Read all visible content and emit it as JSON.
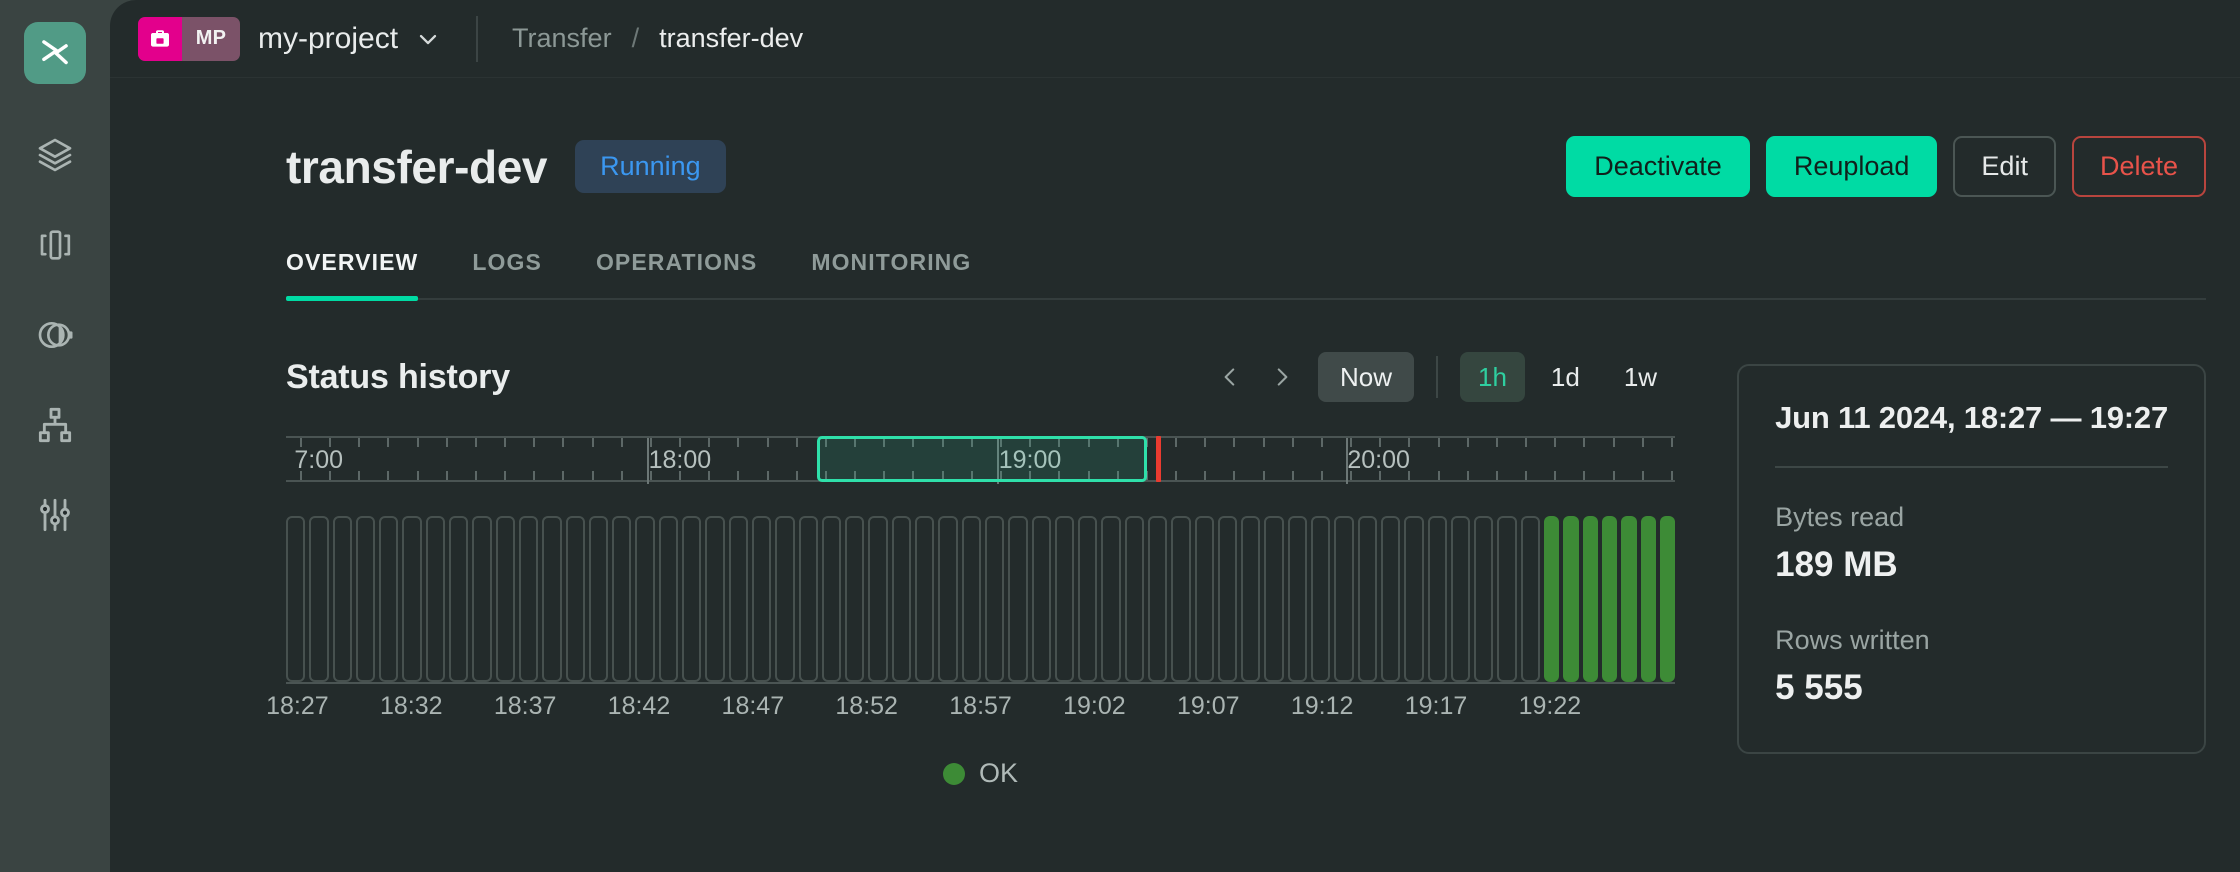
{
  "rail": {
    "logo_icon": "zilliz-logo-icon",
    "items": [
      {
        "icon": "layers-icon",
        "name": "clusters"
      },
      {
        "icon": "brackets-node-icon",
        "name": "pipelines"
      },
      {
        "icon": "contrast-circle-icon",
        "name": "analytics"
      },
      {
        "icon": "hierarchy-icon",
        "name": "topology"
      },
      {
        "icon": "sliders-icon",
        "name": "settings"
      }
    ]
  },
  "topbar": {
    "project_badge": "MP",
    "project_name": "my-project",
    "project_icon": "briefcase-icon",
    "chevron_icon": "chevron-down-icon",
    "breadcrumb": {
      "parent": "Transfer",
      "separator": "/",
      "current": "transfer-dev"
    }
  },
  "header": {
    "title": "transfer-dev",
    "status": "Running",
    "buttons": [
      {
        "label": "Deactivate",
        "style": "primary",
        "name": "deactivate-button"
      },
      {
        "label": "Reupload",
        "style": "primary",
        "name": "reupload-button"
      },
      {
        "label": "Edit",
        "style": "ghost",
        "name": "edit-button"
      },
      {
        "label": "Delete",
        "style": "danger",
        "name": "delete-button"
      }
    ]
  },
  "tabs": [
    {
      "label": "OVERVIEW",
      "active": true
    },
    {
      "label": "LOGS",
      "active": false
    },
    {
      "label": "OPERATIONS",
      "active": false
    },
    {
      "label": "MONITORING",
      "active": false
    }
  ],
  "status_history": {
    "title": "Status history",
    "prev_icon": "chevron-left-icon",
    "next_icon": "chevron-right-icon",
    "now_label": "Now",
    "ranges": [
      {
        "label": "1h",
        "active": true
      },
      {
        "label": "1d",
        "active": false
      },
      {
        "label": "1w",
        "active": false
      }
    ]
  },
  "stats": {
    "date_range": "Jun 11 2024, 18:27 — 19:27",
    "entries": [
      {
        "label": "Bytes read",
        "value": "189 MB"
      },
      {
        "label": "Rows written",
        "value": "5 555"
      }
    ]
  },
  "legend": [
    {
      "label": "OK",
      "color": "#3d8b36"
    }
  ],
  "colors": {
    "accent": "#00dba4",
    "ok": "#3d8b36",
    "danger": "#e8534a",
    "status_text": "#3b97f0",
    "now_marker": "#ea3b30",
    "selection": "#2fe0aa"
  },
  "chart_data": {
    "type": "bar",
    "title": "Status history",
    "xlabel": "",
    "ylabel": "",
    "grid": false,
    "legend_position": "bottom-center",
    "tick_labels": [
      "18:27",
      "18:32",
      "18:37",
      "18:42",
      "18:47",
      "18:52",
      "18:57",
      "19:02",
      "19:07",
      "19:12",
      "19:17",
      "19:22"
    ],
    "tick_indices": [
      0,
      5,
      10,
      15,
      20,
      25,
      30,
      35,
      40,
      45,
      50,
      55
    ],
    "categories": [
      "18:27",
      "18:28",
      "18:29",
      "18:30",
      "18:31",
      "18:32",
      "18:33",
      "18:34",
      "18:35",
      "18:36",
      "18:37",
      "18:38",
      "18:39",
      "18:40",
      "18:41",
      "18:42",
      "18:43",
      "18:44",
      "18:45",
      "18:46",
      "18:47",
      "18:48",
      "18:49",
      "18:50",
      "18:51",
      "18:52",
      "18:53",
      "18:54",
      "18:55",
      "18:56",
      "18:57",
      "18:58",
      "18:59",
      "19:00",
      "19:01",
      "19:02",
      "19:03",
      "19:04",
      "19:05",
      "19:06",
      "19:07",
      "19:08",
      "19:09",
      "19:10",
      "19:11",
      "19:12",
      "19:13",
      "19:14",
      "19:15",
      "19:16",
      "19:17",
      "19:18",
      "19:19",
      "19:20",
      "19:21",
      "19:22",
      "19:23",
      "19:24",
      "19:25",
      "19:26",
      "19:27"
    ],
    "series": [
      {
        "name": "OK",
        "values": [
          0,
          0,
          0,
          0,
          0,
          0,
          0,
          0,
          0,
          0,
          0,
          0,
          0,
          0,
          0,
          0,
          0,
          0,
          0,
          0,
          0,
          0,
          0,
          0,
          0,
          0,
          0,
          0,
          0,
          0,
          0,
          0,
          0,
          0,
          0,
          0,
          0,
          0,
          0,
          0,
          0,
          0,
          0,
          0,
          0,
          0,
          0,
          0,
          0,
          0,
          0,
          0,
          0,
          0,
          1,
          1,
          1,
          1,
          1,
          1,
          1
        ]
      }
    ]
  },
  "ruler": {
    "labels": [
      {
        "text": "7:00",
        "pos_pct": 0.5
      },
      {
        "text": "18:00",
        "pos_pct": 26.0
      },
      {
        "text": "19:00",
        "pos_pct": 51.2
      },
      {
        "text": "20:00",
        "pos_pct": 76.3
      }
    ],
    "selection": {
      "start_pct": 38.2,
      "end_pct": 62.0
    },
    "now_marker_pct": 62.6
  }
}
